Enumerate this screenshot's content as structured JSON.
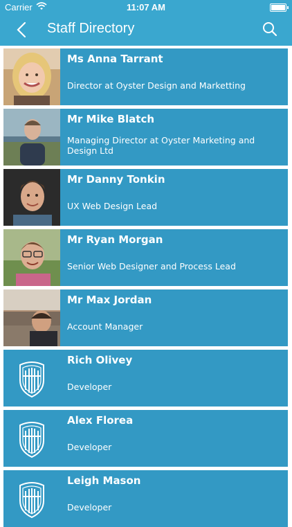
{
  "status_bar": {
    "carrier": "Carrier",
    "time": "11:07 AM"
  },
  "nav": {
    "title": "Staff Directory"
  },
  "staff": [
    {
      "name": "Ms Anna Tarrant",
      "role": "Director at Oyster Design and Marketting"
    },
    {
      "name": "Mr Mike Blatch",
      "role": "Managing Director at Oyster Marketing and Design Ltd"
    },
    {
      "name": "Mr Danny Tonkin",
      "role": "UX Web Design Lead"
    },
    {
      "name": "Mr Ryan Morgan",
      "role": "Senior Web Designer and Process Lead"
    },
    {
      "name": "Mr Max Jordan",
      "role": "Account Manager"
    },
    {
      "name": "Rich Olivey",
      "role": "Developer"
    },
    {
      "name": "Alex Florea",
      "role": "Developer"
    },
    {
      "name": "Leigh Mason",
      "role": "Developer"
    }
  ],
  "colors": {
    "bar": "#3aa7cf",
    "row": "#3399c4"
  }
}
